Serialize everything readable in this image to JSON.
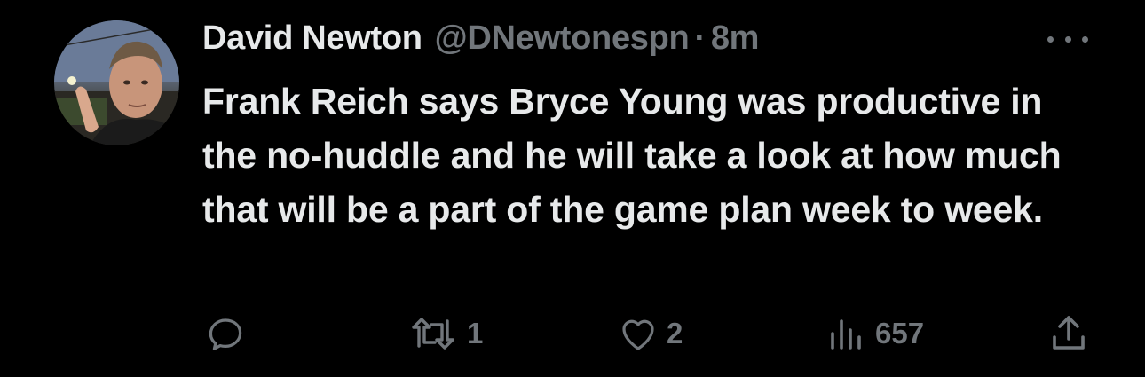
{
  "tweet": {
    "author_name": "David Newton",
    "handle": "@DNewtonespn",
    "separator": "·",
    "time": "8m",
    "text": "Frank Reich says Bryce Young was productive in the no-huddle and he will take a look at how much that will be a part of the game plan week to week."
  },
  "actions": {
    "reply": {
      "icon": "reply-icon"
    },
    "retweet": {
      "icon": "retweet-icon",
      "count": "1"
    },
    "like": {
      "icon": "heart-icon",
      "count": "2"
    },
    "views": {
      "icon": "views-icon",
      "count": "657"
    },
    "share": {
      "icon": "share-icon"
    }
  },
  "colors": {
    "background": "#000000",
    "primary_text": "#e7e9ea",
    "secondary_text": "#71767b"
  }
}
